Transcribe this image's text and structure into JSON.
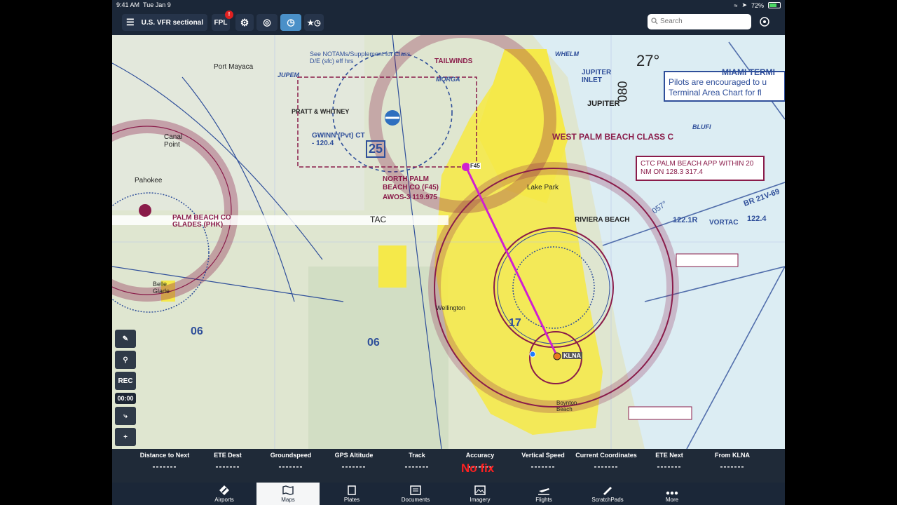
{
  "status": {
    "time": "9:41 AM",
    "date": "Tue Jan 9",
    "battery": "72%"
  },
  "toolbar": {
    "chart_type": "U.S. VFR sectional",
    "fpl_label": "FPL",
    "fpl_badge": "!",
    "search_placeholder": "Search"
  },
  "map": {
    "labels": {
      "west_palm_beach_class_c": "WEST PALM BEACH CLASS C",
      "ctc_box": "CTC PALM BEACH APP WITHIN 20 NM ON 128.3  317.4",
      "miami_terminal": "MIAMI TERMI",
      "pilots_note": "Pilots are encouraged to u Terminal Area Chart for fl",
      "jupiter": "JUPITER",
      "jupiter_inlet": "JUPITER INLET",
      "north_palm_beach": "NORTH PALM BEACH CO (F45)",
      "awos": "AWOS-3 119.975",
      "pratt_whitney": "PRATT & WHITNEY",
      "gwinn": "GWINN (Pvt) CT - 120.4",
      "palm_beach_glades": "PALM BEACH CO GLADES (PHK)",
      "pahokee": "Pahokee",
      "canal_point": "Canal Point",
      "port_mayaca": "Port Mayaca",
      "wellington": "Wellington",
      "belle_glade": "Belle Glade",
      "lake_park": "Lake Park",
      "riviera_beach": "RIVIERA BEACH",
      "boynton_beach": "Boynton Beach",
      "klna": "KLNA",
      "f45": "F45",
      "tac": "TAC",
      "vortac": "VORTAC",
      "blufi": "BLUFI",
      "tailwinds": "TAILWINDS",
      "whelm": "WHELM",
      "jupem": "JUPEM",
      "morga": "MORGA",
      "see_notams": "See NOTAMs/Supplement for Class D/E (sfc) eff hrs",
      "course_27": "27°",
      "course_080": "080",
      "heading_057": "057°",
      "freq_122_1r": "122.1R",
      "freq_122_4": "122.4",
      "br_21v": "BR 21V-69",
      "mef_17": "17",
      "mef_06a": "06",
      "mef_06b": "06",
      "mef_25": "25"
    }
  },
  "side_tools": {
    "rec": "REC",
    "timer": "00:00",
    "zoom_in": "+",
    "zoom_out": "−"
  },
  "infobar": {
    "cells": [
      {
        "label": "Distance to Next",
        "value": "-------"
      },
      {
        "label": "ETE Dest",
        "value": "-------"
      },
      {
        "label": "Groundspeed",
        "value": "-------"
      },
      {
        "label": "GPS Altitude",
        "value": "-------"
      },
      {
        "label": "Track",
        "value": "-------"
      },
      {
        "label": "Accuracy",
        "value": "-------"
      },
      {
        "label": "Vertical Speed",
        "value": "-------"
      },
      {
        "label": "Current Coordinates",
        "value": "-------"
      },
      {
        "label": "ETE Next",
        "value": "-------"
      },
      {
        "label": "From KLNA",
        "value": "-------"
      }
    ],
    "no_fix": "No fix"
  },
  "tabs": [
    {
      "label": "Airports",
      "icon": "airport-icon"
    },
    {
      "label": "Maps",
      "icon": "map-icon"
    },
    {
      "label": "Plates",
      "icon": "plates-icon"
    },
    {
      "label": "Documents",
      "icon": "documents-icon"
    },
    {
      "label": "Imagery",
      "icon": "imagery-icon"
    },
    {
      "label": "Flights",
      "icon": "flights-icon"
    },
    {
      "label": "ScratchPads",
      "icon": "scratchpad-icon"
    },
    {
      "label": "More",
      "icon": "more-icon"
    }
  ],
  "colors": {
    "accent": "#4a90c8",
    "airspace": "#8a1c4a",
    "route": "#d020d0",
    "city": "#f5e94a"
  }
}
